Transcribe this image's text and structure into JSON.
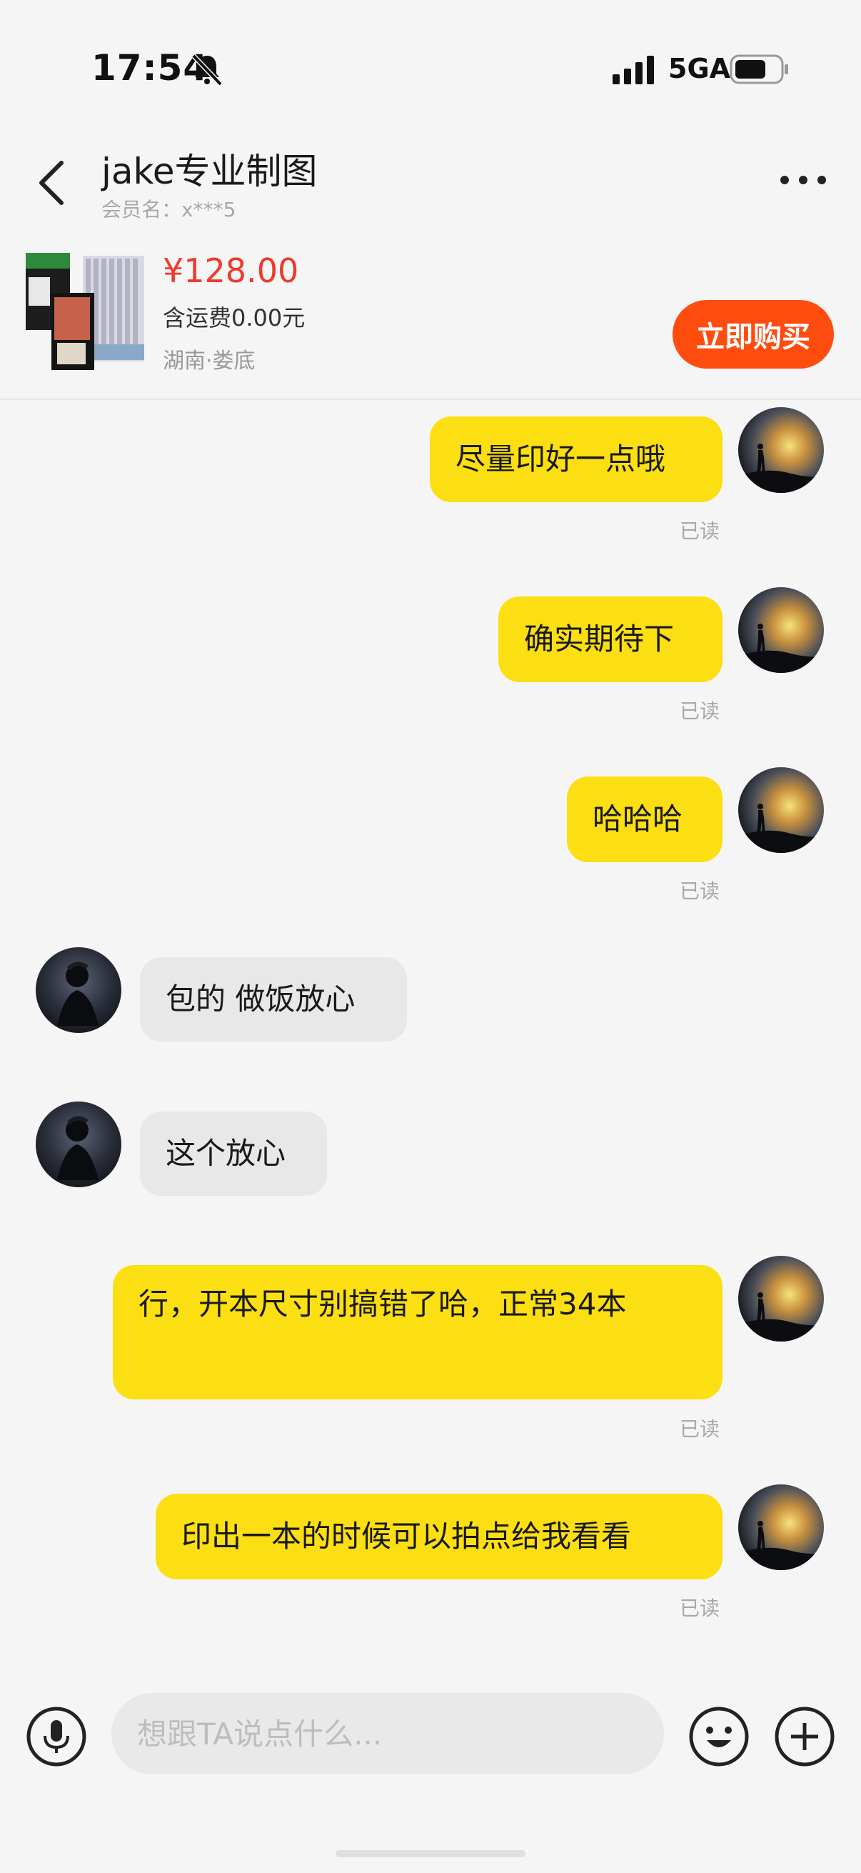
{
  "status_bar": {
    "time": "17:54",
    "network": "5GA",
    "icons": [
      "bell-slash-icon",
      "signal-icon",
      "battery-icon"
    ]
  },
  "nav": {
    "title": "jake专业制图",
    "member_label": "会员名：x***5",
    "back_icon": "chevron-left-icon",
    "more_icon": "more-dots-icon"
  },
  "product": {
    "price": "¥128.00",
    "shipping": "含运费0.00元",
    "location": "湖南·娄底",
    "buy_label": "立即购买"
  },
  "messages": [
    {
      "sender": "me",
      "text": "尽量印好一点哦",
      "status": "已读"
    },
    {
      "sender": "me",
      "text": "确实期待下",
      "status": "已读"
    },
    {
      "sender": "me",
      "text": "哈哈哈",
      "status": "已读"
    },
    {
      "sender": "them",
      "text": "包的 做饭放心"
    },
    {
      "sender": "them",
      "text": "这个放心"
    },
    {
      "sender": "me",
      "text": "行，开本尺寸别搞错了哈，正常34本",
      "status": "已读"
    },
    {
      "sender": "me",
      "text": "印出一本的时候可以拍点给我看看",
      "status": "已读"
    }
  ],
  "input": {
    "placeholder": "想跟TA说点什么...",
    "icons": [
      "microphone-icon",
      "emoji-icon",
      "plus-icon"
    ]
  },
  "colors": {
    "my_bubble": "#fbdf13",
    "their_bubble": "#e8e8e8",
    "buy_button": "#ff4d10",
    "price": "#f0392b"
  }
}
